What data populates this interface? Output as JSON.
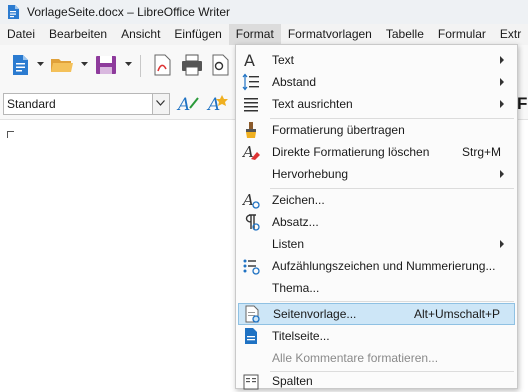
{
  "window": {
    "title": "VorlageSeite.docx – LibreOffice Writer"
  },
  "menubar": {
    "items": [
      "Datei",
      "Bearbeiten",
      "Ansicht",
      "Einfügen",
      "Format",
      "Formatvorlagen",
      "Tabelle",
      "Formular",
      "Extr"
    ]
  },
  "fmtbar": {
    "paragraph_style": "Standard",
    "partial_label": "F"
  },
  "format_menu": {
    "items": [
      {
        "label": "Text",
        "icon": "text-a-icon",
        "submenu": true
      },
      {
        "label": "Abstand",
        "icon": "spacing-icon",
        "submenu": true
      },
      {
        "label": "Text ausrichten",
        "icon": "align-text-icon",
        "submenu": true
      },
      {
        "label": "Formatierung übertragen",
        "icon": "paintbrush-icon"
      },
      {
        "label": "Direkte Formatierung löschen",
        "icon": "clear-formatting-icon",
        "shortcut": "Strg+M"
      },
      {
        "label": "Hervorhebung",
        "icon": "",
        "submenu": true
      },
      {
        "label": "Zeichen...",
        "icon": "character-icon"
      },
      {
        "label": "Absatz...",
        "icon": "paragraph-icon"
      },
      {
        "label": "Listen",
        "icon": "",
        "submenu": true
      },
      {
        "label": "Aufzählungszeichen und Nummerierung...",
        "icon": "bullets-numbering-icon"
      },
      {
        "label": "Thema...",
        "icon": ""
      },
      {
        "label": "Seitenvorlage...",
        "icon": "page-style-icon",
        "shortcut": "Alt+Umschalt+P",
        "highlighted": true
      },
      {
        "label": "Titelseite...",
        "icon": "title-page-icon"
      },
      {
        "label": "Alle Kommentare formatieren...",
        "icon": "",
        "disabled": true
      },
      {
        "label": "Spalten",
        "icon": "columns-icon"
      }
    ]
  },
  "colors": {
    "titlebar": "#eef1f4",
    "menubar": "#f3f3f3",
    "active_menu": "#dcdcdc",
    "highlight": "#cde6f7",
    "accent_blue": "#1f72c3",
    "save_purple": "#8e3b9c"
  }
}
